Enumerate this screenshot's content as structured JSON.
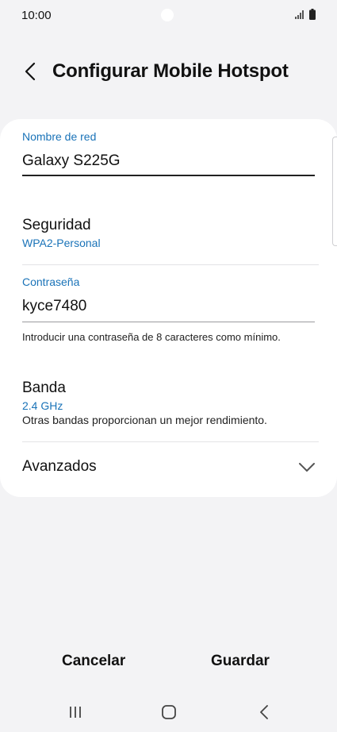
{
  "status_bar": {
    "time": "10:00"
  },
  "header": {
    "title": "Configurar Mobile Hotspot"
  },
  "network_name": {
    "label": "Nombre de red",
    "value": "Galaxy S225G"
  },
  "security": {
    "title": "Seguridad",
    "value": "WPA2-Personal"
  },
  "password": {
    "label": "Contraseña",
    "value": "kyce7480",
    "helper": "Introducir una contraseña de 8 caracteres como mínimo."
  },
  "band": {
    "title": "Banda",
    "value": "2.4 GHz",
    "description": "Otras bandas proporcionan un mejor rendimiento."
  },
  "advanced": {
    "title": "Avanzados"
  },
  "actions": {
    "cancel": "Cancelar",
    "save": "Guardar"
  },
  "colors": {
    "accent": "#1a73b8",
    "background": "#f3f3f5",
    "card": "#ffffff"
  },
  "icons": {
    "back": "arrow-left-icon",
    "chevron": "chevron-down-icon",
    "nav_recents": "recent-apps-icon",
    "nav_home": "home-icon",
    "nav_back": "back-icon"
  }
}
